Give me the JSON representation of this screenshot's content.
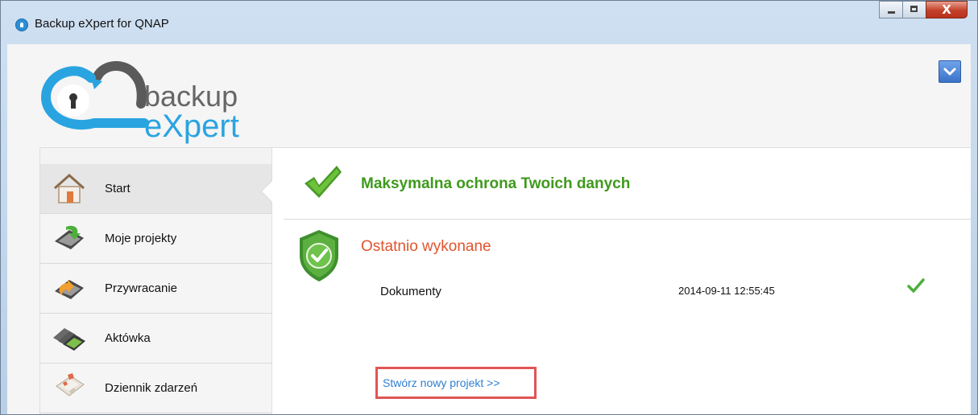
{
  "window": {
    "title": "Backup eXpert for QNAP",
    "close_glyph": "X"
  },
  "logo": {
    "line1": "backup",
    "line2": "eXpert"
  },
  "sidebar": {
    "items": [
      {
        "label": "Start",
        "icon": "home-icon",
        "active": true
      },
      {
        "label": "Moje projekty",
        "icon": "projects-icon",
        "active": false
      },
      {
        "label": "Przywracanie",
        "icon": "restore-icon",
        "active": false
      },
      {
        "label": "Aktówka",
        "icon": "briefcase-icon",
        "active": false
      },
      {
        "label": "Dziennik zdarzeń",
        "icon": "calendar-log-icon",
        "active": false
      }
    ]
  },
  "main": {
    "headline": "Maksymalna ochrona Twoich danych",
    "recent_title": "Ostatnio wykonane",
    "recent": [
      {
        "name": "Dokumenty",
        "date": "2014-09-11 12:55:45",
        "status": "success"
      }
    ],
    "new_project_link": "Stwórz nowy projekt >>"
  },
  "colors": {
    "accent_green": "#3f9a1c",
    "accent_red": "#e0542e",
    "link_blue": "#2f7fd1",
    "brand_blue": "#2aa4e0"
  }
}
